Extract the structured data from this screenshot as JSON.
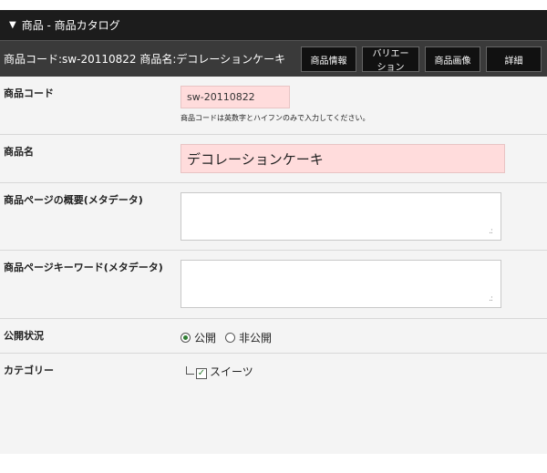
{
  "header": {
    "collapse_icon": "triangle-down-icon",
    "title": "商品 - 商品カタログ"
  },
  "info_bar": {
    "summary": "商品コード:sw-20110822 商品名:デコレーションケーキ",
    "buttons": [
      {
        "label": "商品情報"
      },
      {
        "label": "バリエーション"
      },
      {
        "label": "商品画像"
      },
      {
        "label": "詳細"
      }
    ]
  },
  "form": {
    "product_code": {
      "label": "商品コード",
      "value": "sw-20110822",
      "hint": "商品コードは英数字とハイフンのみで入力してください。"
    },
    "product_name": {
      "label": "商品名",
      "value": "デコレーションケーキ"
    },
    "meta_description": {
      "label": "商品ページの概要(メタデータ)",
      "value": ""
    },
    "meta_keywords": {
      "label": "商品ページキーワード(メタデータ)",
      "value": ""
    },
    "status": {
      "label": "公開状況",
      "options": [
        {
          "label": "公開",
          "selected": true
        },
        {
          "label": "非公開",
          "selected": false
        }
      ]
    },
    "category": {
      "label": "カテゴリー",
      "items": [
        {
          "label": "スイーツ",
          "checked": true
        }
      ]
    }
  },
  "colors": {
    "title_bar": "#1c1c1c",
    "info_bar": "#3a3a3a",
    "required_field": "#ffdcdc",
    "checked_accent": "#2e7d32"
  }
}
